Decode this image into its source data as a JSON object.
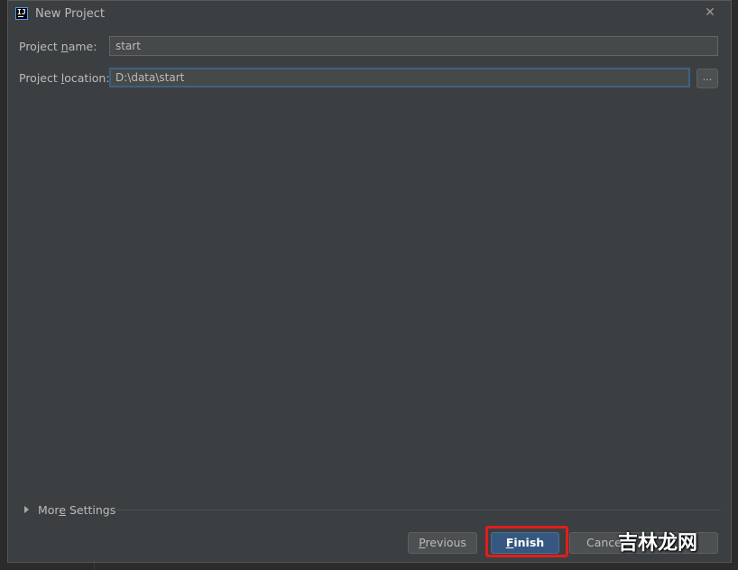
{
  "dialog": {
    "title": "New Project",
    "app_icon_text": "IJ"
  },
  "form": {
    "name_label_pre": "Project ",
    "name_label_mnemonic": "n",
    "name_label_post": "ame:",
    "name_value": "start",
    "location_label_pre": "Project ",
    "location_label_mnemonic": "l",
    "location_label_post": "ocation:",
    "location_value": "D:\\data\\start",
    "browse_label": "..."
  },
  "more_settings": {
    "label_pre": "Mor",
    "label_mnemonic": "e",
    "label_post": " Settings"
  },
  "buttons": {
    "previous_mnemonic": "P",
    "previous_rest": "revious",
    "finish_mnemonic": "F",
    "finish_rest": "inish",
    "cancel_label": "Cance"
  },
  "watermark": "吉林龙网",
  "colors": {
    "dialog_bg": "#3c3f41",
    "field_bg": "#45494a",
    "focus_border": "#3d6185",
    "default_button": "#365880",
    "highlight": "#e21d1d"
  }
}
